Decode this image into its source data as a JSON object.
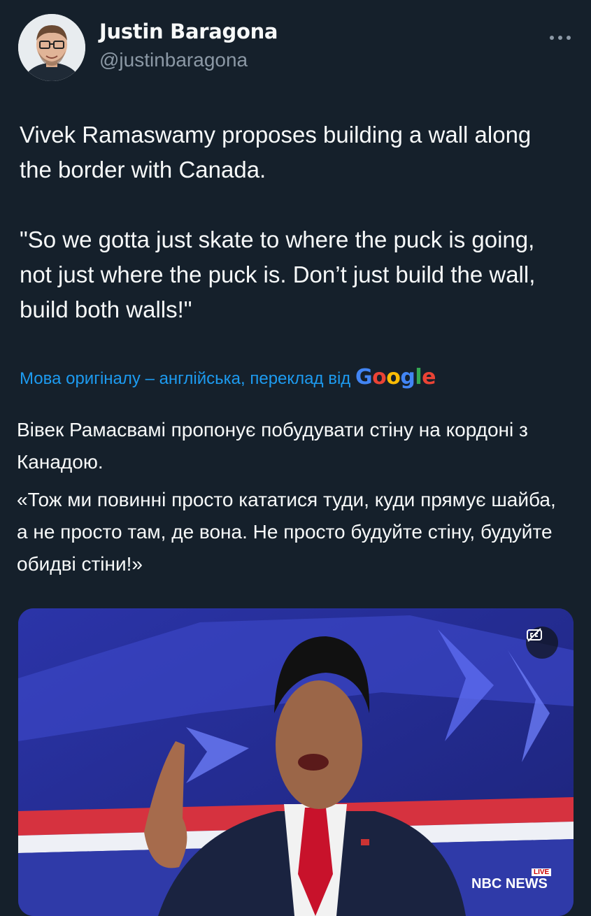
{
  "user": {
    "display_name": "Justin Baragona",
    "handle": "@justinbaragona"
  },
  "tweet": {
    "paragraphs": [
      "Vivek Ramaswamy proposes building a wall along the border with Canada.",
      "\"So we gotta just skate to where the puck is going, not just where the puck is. Don’t just build the wall, build both walls!\""
    ]
  },
  "translation": {
    "notice": "Мова оригіналу – англійська, переклад від",
    "provider": "Google",
    "paragraphs": [
      "Вівек Рамасвамі пропонує побудувати стіну на кордоні з Канадою.",
      "«Тож ми повинні просто кататися туди, куди прямує шайба, а не просто там, де вона. Не просто будуйте стіну, будуйте обидві стіни!»"
    ]
  },
  "media": {
    "broadcaster_logo": "NBC NEWS",
    "live_badge": "LIVE",
    "captions_icon": "captions-icon"
  },
  "icons": {
    "more": "more-options-icon",
    "avatar": "avatar"
  },
  "colors": {
    "background": "#15202b",
    "link": "#1d9bf0",
    "secondary_text": "#8b98a5"
  }
}
